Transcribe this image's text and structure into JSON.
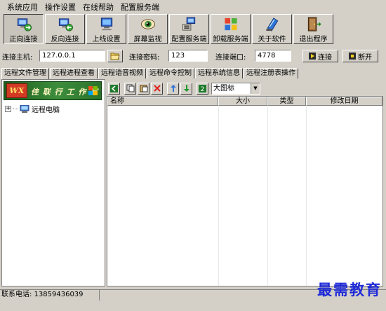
{
  "menu": [
    "系统应用",
    "操作设置",
    "在线帮助",
    "配置服务端"
  ],
  "toolbar": [
    {
      "label": "正向连接",
      "icon": "forward-connect-icon",
      "active": true
    },
    {
      "label": "反向连接",
      "icon": "reverse-connect-icon"
    },
    {
      "label": "上线设置",
      "icon": "online-settings-icon"
    },
    {
      "label": "屏幕监视",
      "icon": "screen-monitor-icon"
    },
    {
      "label": "配置服务端",
      "icon": "config-server-icon"
    },
    {
      "label": "卸载服务端",
      "icon": "uninstall-server-icon"
    },
    {
      "label": "关于软件",
      "icon": "about-icon"
    },
    {
      "label": "退出程序",
      "icon": "exit-icon"
    }
  ],
  "connection": {
    "host_label": "连接主机:",
    "host_value": "127.0.0.1",
    "password_label": "连接密码:",
    "password_value": "123",
    "port_label": "连接端口:",
    "port_value": "4778",
    "connect_label": "连接",
    "disconnect_label": "断开"
  },
  "tabs": [
    "远程文件管理",
    "远程进程查看",
    "远程语音视频",
    "远程命令控制",
    "远程系统信息",
    "远程注册表操作"
  ],
  "banner": {
    "logo": "WX",
    "text": "佳 联 行 工 作 室"
  },
  "tree": {
    "root": "远程电脑"
  },
  "view": {
    "selected": "大图标"
  },
  "columns": [
    "名称",
    "大小",
    "类型",
    "修改日期"
  ],
  "status": {
    "text": "联系电话: 13859436039"
  },
  "watermark": "最需教育",
  "colors": {
    "face": "#d4d0c8",
    "banner": "#2b722b",
    "watermark": "#1f2bd8"
  }
}
